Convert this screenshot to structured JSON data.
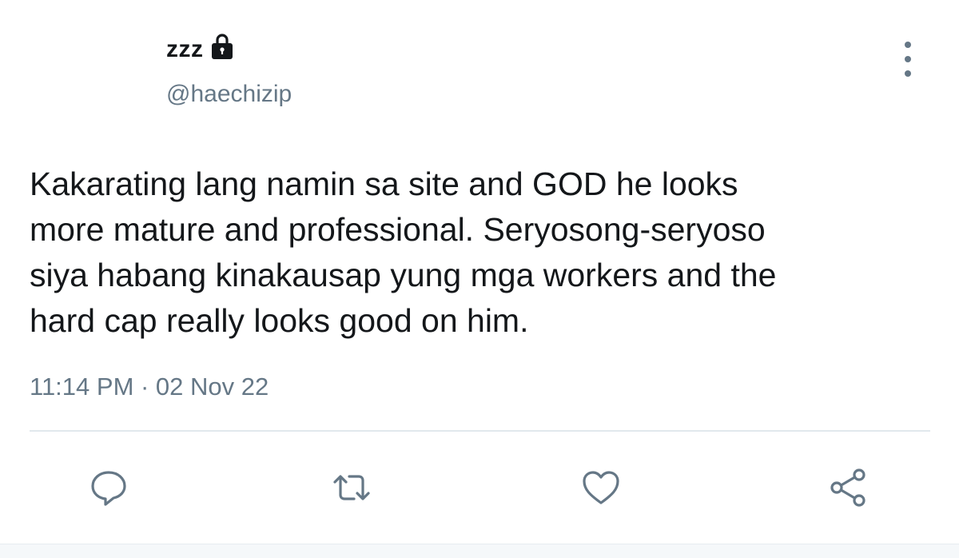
{
  "tweet": {
    "author": {
      "display_name": "zzz",
      "handle": "@haechizip",
      "protected": true
    },
    "text": "Kakarating lang namin sa site and GOD he looks\nmore mature and professional. Seryosong-seryoso\nsiya habang kinakausap yung mga workers and the\nhard cap really looks good on him.",
    "timestamp": "11:14 PM · 02 Nov 22"
  },
  "icons": {
    "lock": "lock-icon",
    "more": "more-vertical-icon",
    "reply": "reply-icon",
    "retweet": "retweet-icon",
    "like": "heart-icon",
    "share": "share-icon"
  },
  "colors": {
    "text": "#14171a",
    "secondary": "#657786",
    "divider": "#e1e8ed"
  }
}
